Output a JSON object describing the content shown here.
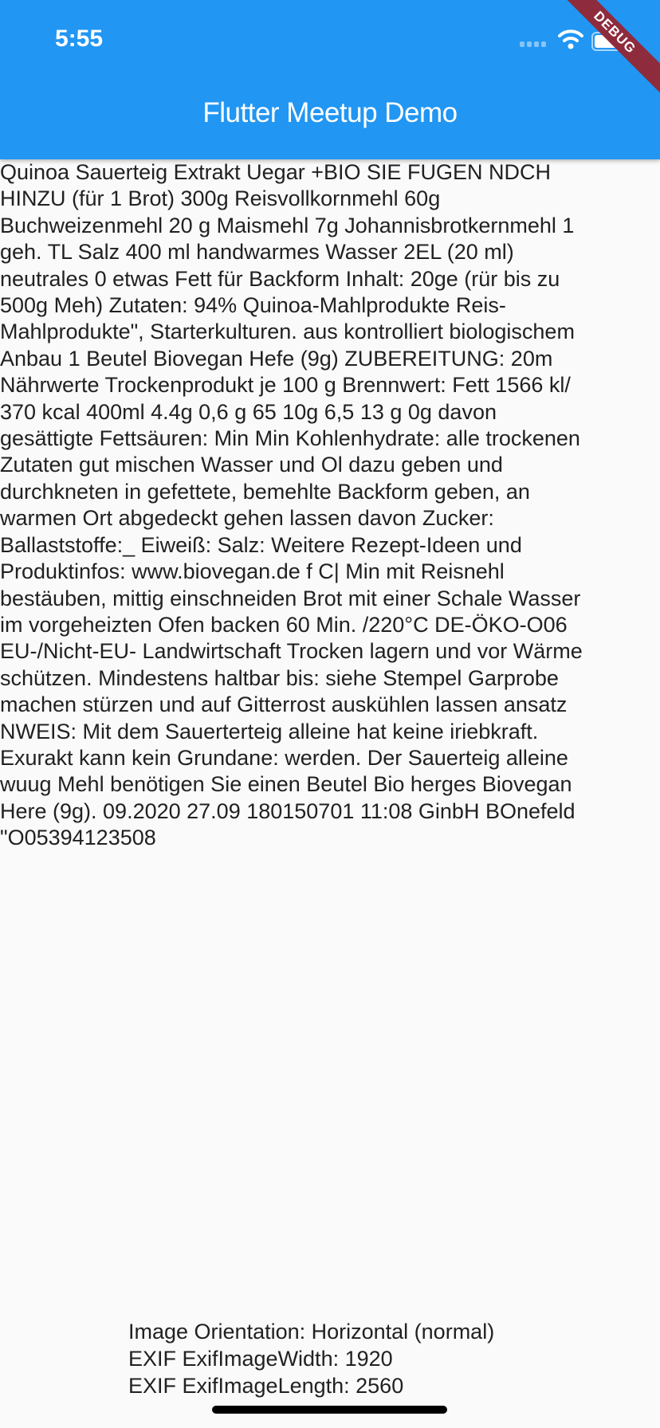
{
  "status_bar": {
    "time": "5:55",
    "icons": [
      "signal-icon",
      "wifi-icon",
      "battery-icon"
    ]
  },
  "app_bar": {
    "title": "Flutter Meetup Demo",
    "color": "#2196f3"
  },
  "debug_banner": "DEBUG",
  "ocr_text": {
    "lines": [
      " Quinoa Sauerteig Extrakt Uegar +BIO SIE FUGEN NDCH",
      "HINZU (für 1 Brot) 300g Reisvollkornmehl 60g",
      "Buchweizenmehl 20 g Maismehl 7g Johannisbrotkernmehl 1",
      "geh. TL Salz 400 ml handwarmes Wasser 2EL (20 ml)",
      "neutrales 0 etwas Fett für Backform Inhalt: 20ge (rür bis zu",
      "500g Meh) Zutaten: 94% Quinoa-Mahlprodukte Reis-",
      "Mahlprodukte\", Starterkulturen. aus kontrolliert biologischem",
      "Anbau 1 Beutel Biovegan Hefe (9g) ZUBEREITUNG: 20m",
      "Nährwerte Trockenprodukt je 100 g Brennwert: Fett 1566 kl/",
      "370 kcal 400ml 4.4g 0,6 g 65 10g 6,5 13 g 0g davon",
      "gesättigte Fettsäuren: Min Min Kohlenhydrate: alle trockenen",
      "Zutaten gut mischen Wasser und Ol dazu geben und",
      "durchkneten in gefettete, bemehlte Backform geben, an",
      "warmen Ort abgedeckt gehen lassen davon Zucker:",
      "Ballaststoffe:_ Eiweiß: Salz: Weitere Rezept-Ideen und",
      "Produktinfos: www.biovegan.de f C| Min mit Reisnehl",
      "bestäuben, mittig einschneiden Brot mit einer Schale Wasser",
      "im vorgeheizten Ofen backen 60 Min. /220°C DE-ÖKO-O06",
      "EU-/Nicht-EU- Landwirtschaft Trocken lagern und vor Wärme",
      "schützen. Mindestens haltbar bis: siehe Stempel Garprobe",
      "machen stürzen und auf Gitterrost auskühlen lassen ansatz",
      "NWEIS: Mit dem Sauerterteig alleine hat keine iriebkraft.",
      "Exurakt kann kein Grundane: werden. Der Sauerteig alleine",
      "wuug Mehl benötigen Sie einen Beutel Bio herges Biovegan",
      "Here (9g). 09.2020 27.09 180150701 11:08 GinbH BOnefeld",
      "\"O05394123508"
    ]
  },
  "exif": {
    "orientation": "Image Orientation: Horizontal (normal)",
    "width": "EXIF ExifImageWidth: 1920",
    "length": "EXIF ExifImageLength: 2560"
  }
}
